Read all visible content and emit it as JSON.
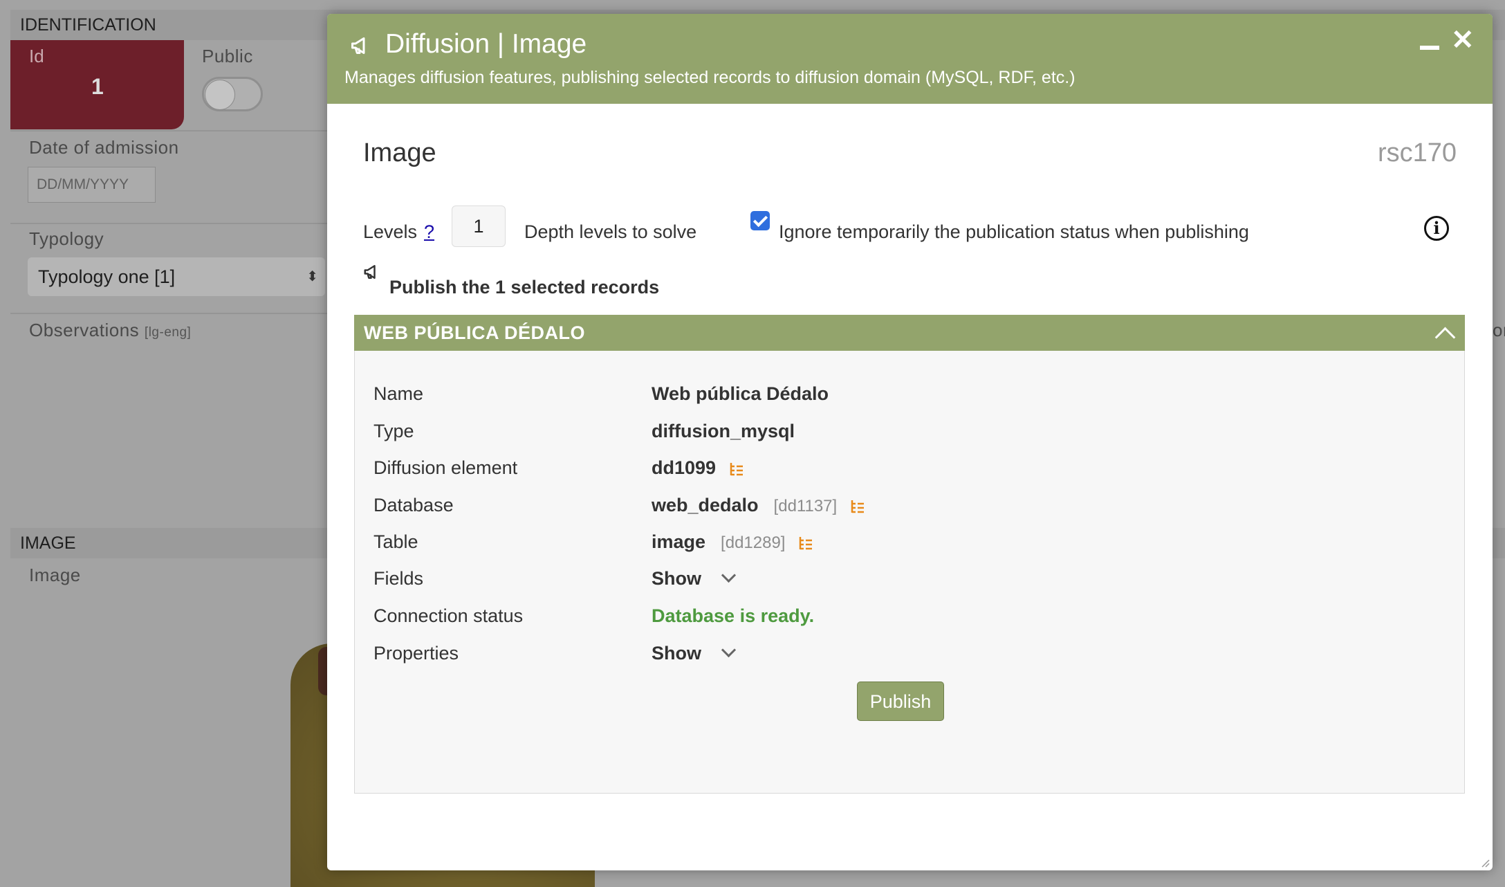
{
  "background": {
    "identification_header": "IDENTIFICATION",
    "id_label": "Id",
    "id_value": "1",
    "public_label": "Public",
    "date_label": "Date of admission",
    "date_placeholder": "DD/MM/YYYY",
    "typology_label": "Typology",
    "typology_value": "Typology one [1]",
    "observations_label": "Observations",
    "observations_lang": "[lg-eng]",
    "image_header": "IMAGE",
    "image_label": "Image",
    "right_clip": "or"
  },
  "modal": {
    "title": "Diffusion | Image",
    "subtitle": "Manages diffusion features, publishing selected records to diffusion domain (MySQL, RDF, etc.)",
    "section_title": "Image",
    "tipo": "rsc170",
    "levels_label": "Levels",
    "levels_help": "?",
    "levels_value": "1",
    "depth_label": "Depth levels to solve",
    "ignore_checked": true,
    "ignore_label": "Ignore temporarily the publication status when publishing",
    "publish_selected_label": "Publish the 1 selected records",
    "panel": {
      "title": "WEB PÚBLICA DÉDALO",
      "rows": {
        "name_label": "Name",
        "name_value": "Web pública Dédalo",
        "type_label": "Type",
        "type_value": "diffusion_mysql",
        "element_label": "Diffusion element",
        "element_value": "dd1099",
        "database_label": "Database",
        "database_value": "web_dedalo",
        "database_tipo": "[dd1137]",
        "table_label": "Table",
        "table_value": "image",
        "table_tipo": "[dd1289]",
        "fields_label": "Fields",
        "fields_value": "Show",
        "status_label": "Connection status",
        "status_value": "Database is ready.",
        "properties_label": "Properties",
        "properties_value": "Show"
      },
      "publish_button": "Publish"
    }
  },
  "colors": {
    "header_green": "#93a46c",
    "status_green": "#4e9a3f",
    "tree_orange": "#e88a1a",
    "id_red": "#6d1f2a"
  }
}
